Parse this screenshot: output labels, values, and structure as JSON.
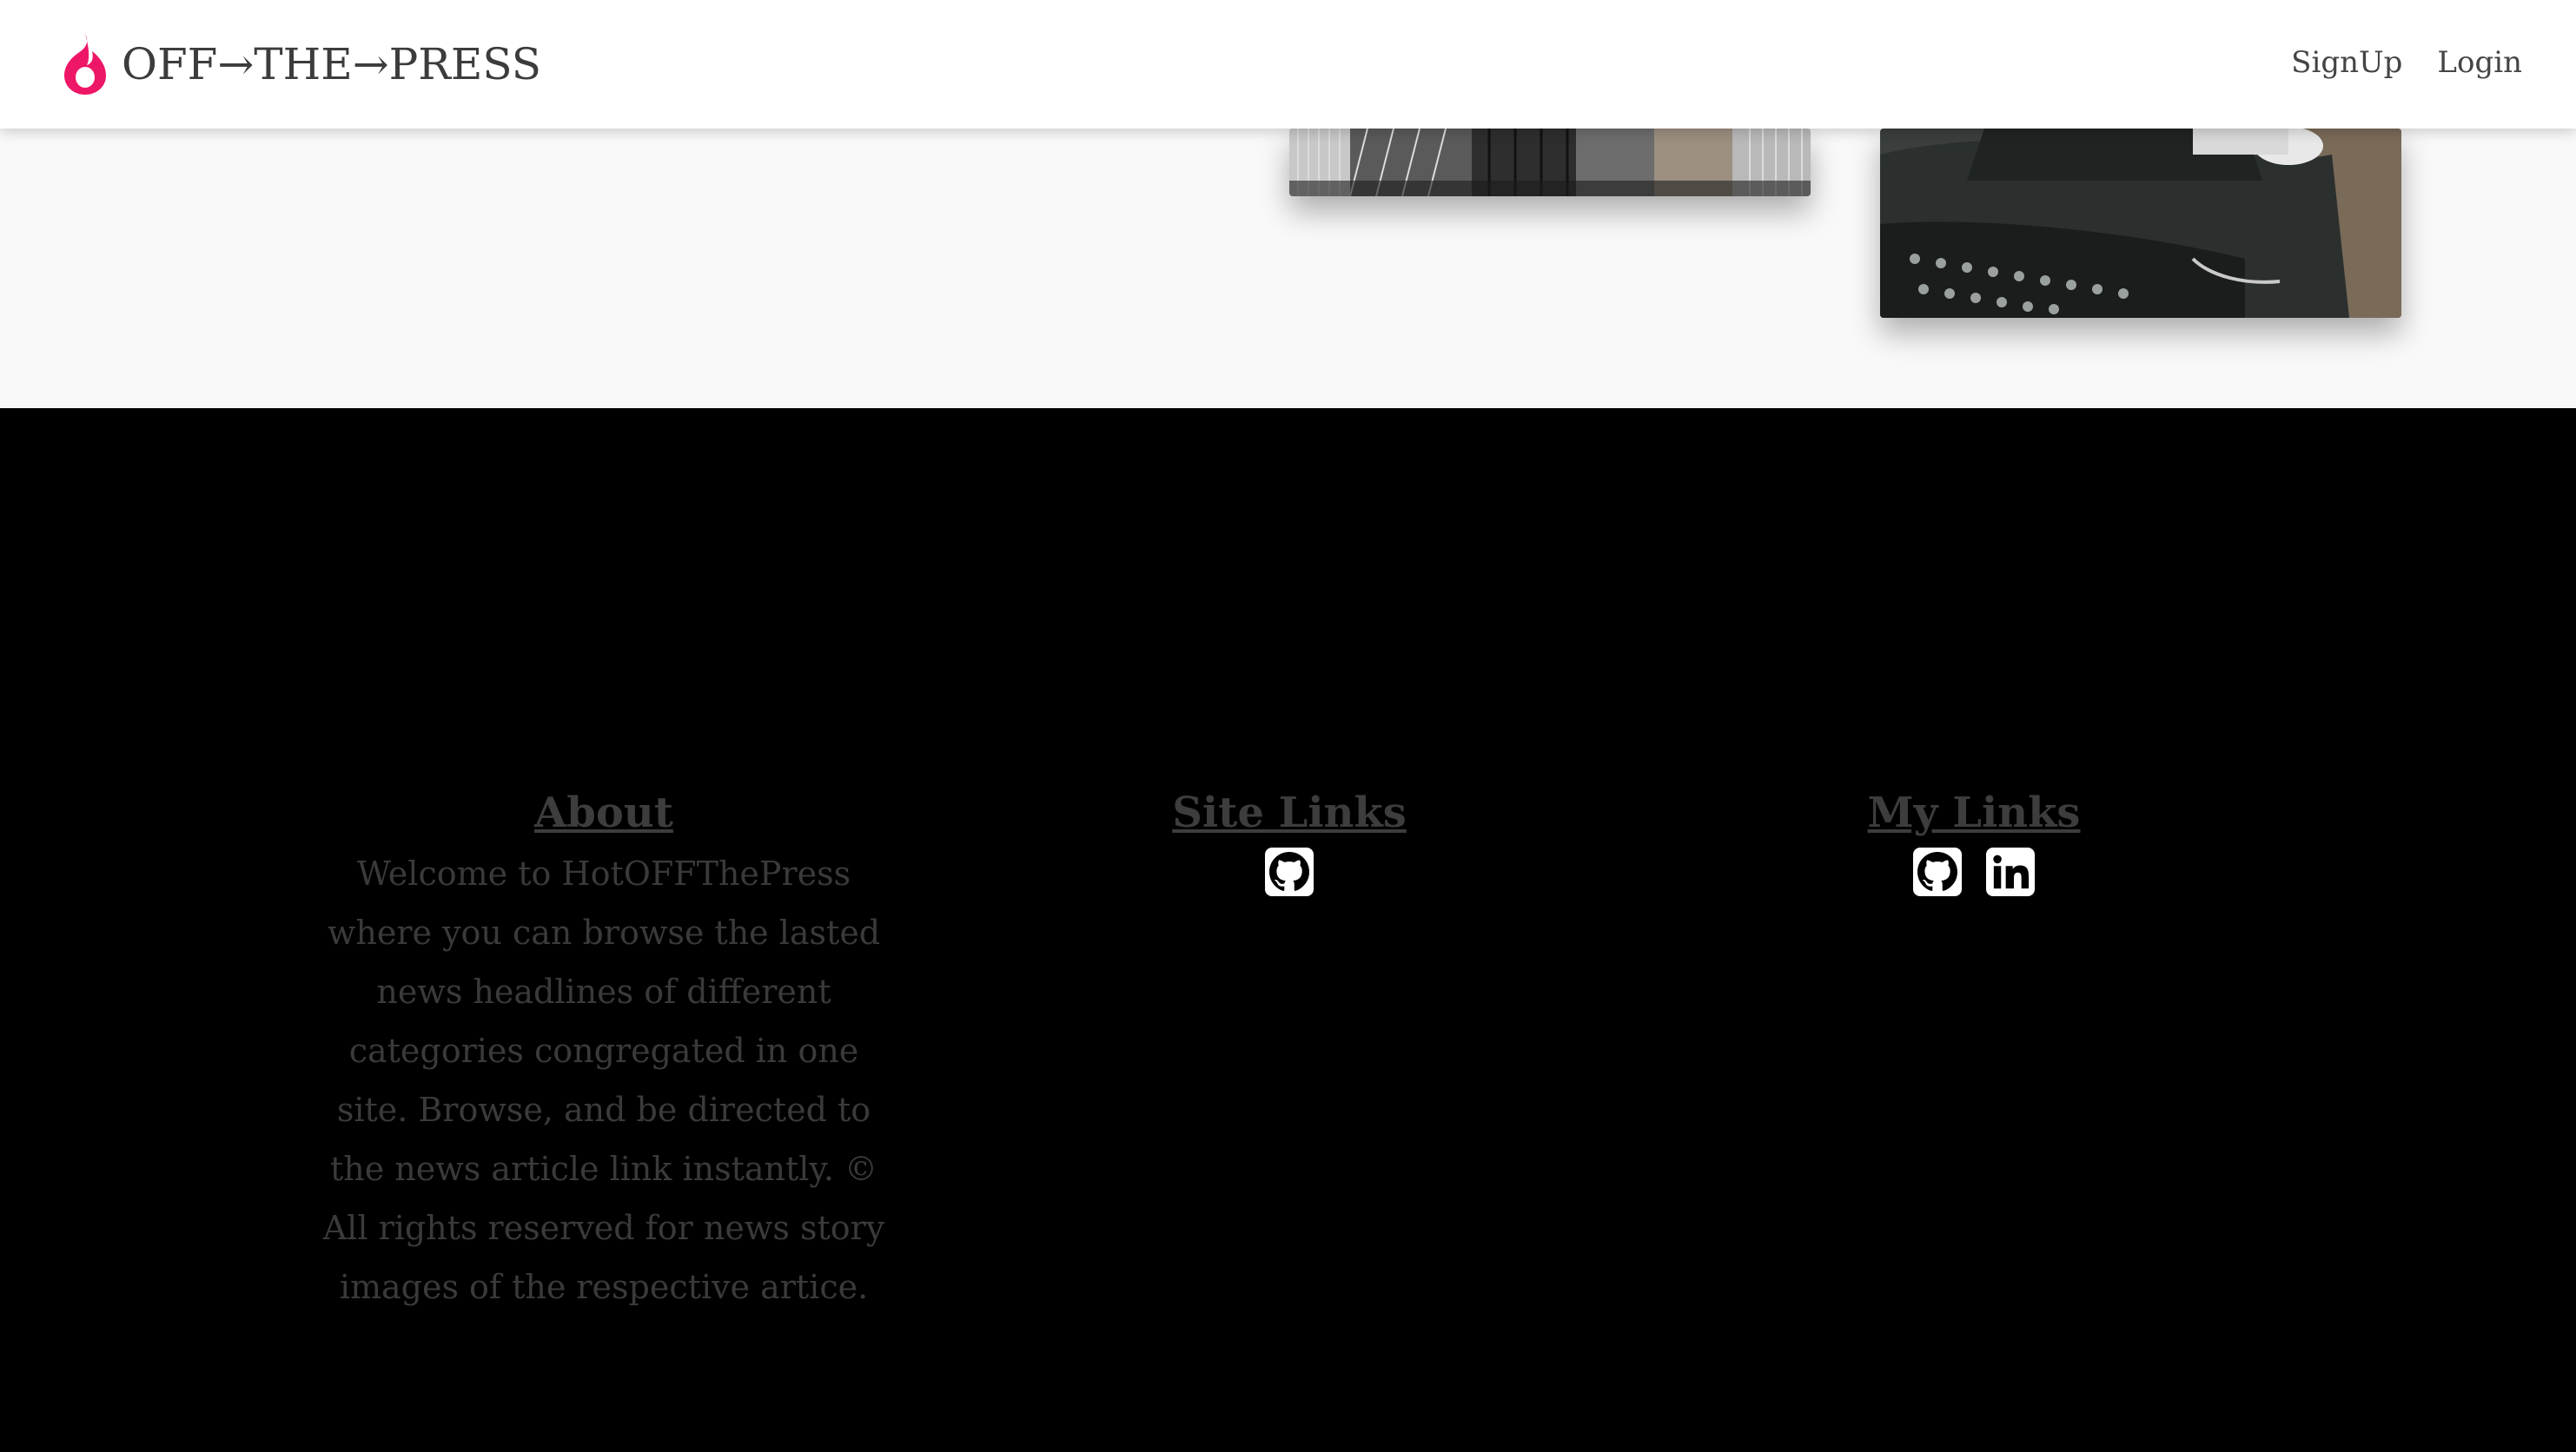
{
  "navbar": {
    "brand_text": "OFF→THE→PRESS",
    "links": [
      "SignUp",
      "Login"
    ]
  },
  "cards": {
    "building_image_icon": "building-photo",
    "typewriter_image_icon": "typewriter-photo"
  },
  "footer": {
    "about": {
      "heading": "About",
      "text": "Welcome to HotOFFThePress where you can browse the lasted news headlines of different categories congregated in one site. Browse, and be directed to the news article link instantly. © All rights reserved for news story images of the respective artice."
    },
    "site_links": {
      "heading": "Site Links",
      "icons": [
        "github-icon"
      ]
    },
    "my_links": {
      "heading": "My Links",
      "icons": [
        "github-icon",
        "linkedin-icon"
      ]
    }
  },
  "colors": {
    "brand_accent": "#ee1767",
    "navbar_bg": "#ffffff",
    "strip_bg": "#f9f9f9",
    "footer_bg": "#000000",
    "footer_text": "#3a3a3a"
  }
}
